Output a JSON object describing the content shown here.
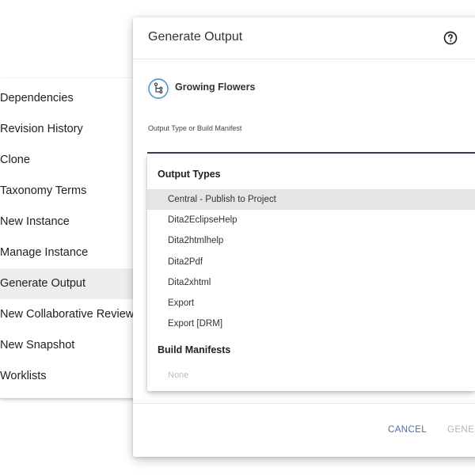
{
  "context_menu": {
    "items": [
      {
        "label": "Dependencies"
      },
      {
        "label": "Revision History"
      },
      {
        "label": "Clone"
      },
      {
        "label": "Taxonomy Terms"
      },
      {
        "label": "New Instance"
      },
      {
        "label": "Manage Instance"
      },
      {
        "label": "Generate Output"
      },
      {
        "label": "New Collaborative Review"
      },
      {
        "label": "New Snapshot"
      },
      {
        "label": "Worklists"
      }
    ],
    "active_index": 6
  },
  "dialog": {
    "title": "Generate Output",
    "help_icon": "help-circle-icon",
    "topic": {
      "icon": "map-tree-icon",
      "name": "Growing Flowers"
    },
    "field_label": "Output Type or Build Manifest",
    "footer": {
      "cancel_label": "CANCEL",
      "generate_label": "GENER"
    }
  },
  "dropdown": {
    "output_types_header": "Output Types",
    "output_types": [
      {
        "label": "Central - Publish to Project"
      },
      {
        "label": "Dita2EclipseHelp"
      },
      {
        "label": "Dita2htmlhelp"
      },
      {
        "label": "Dita2Pdf"
      },
      {
        "label": "Dita2xhtml"
      },
      {
        "label": "Export"
      },
      {
        "label": "Export [DRM]"
      }
    ],
    "highlighted_index": 0,
    "build_manifests_header": "Build Manifests",
    "build_manifests_empty": "None"
  },
  "colors": {
    "accent_link": "#4a6fa5",
    "topic_icon": "#3a8fc7",
    "input_underline": "#3b3b4f",
    "highlight": "#e5e5e5",
    "active_menu": "#eeeeee"
  }
}
